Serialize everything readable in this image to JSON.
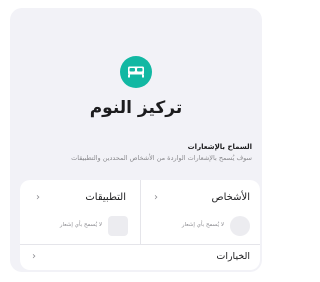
{
  "focus": {
    "title": "تركيز النوم",
    "icon": "bed-icon",
    "accent_color": "#12b8a3"
  },
  "notifications": {
    "label": "السماح بالإشعارات",
    "description": "سوف يُسمح بالإشعارات الواردة من الأشخاص المحددين والتطبيقات"
  },
  "people": {
    "title": "الأشخاص",
    "empty_text": "لا يُسمح بأي إشعار"
  },
  "apps": {
    "title": "التطبيقات",
    "empty_text": "لا يُسمح بأي إشعار"
  },
  "options": {
    "label": "الخيارات"
  },
  "chevron_glyph": "‹"
}
